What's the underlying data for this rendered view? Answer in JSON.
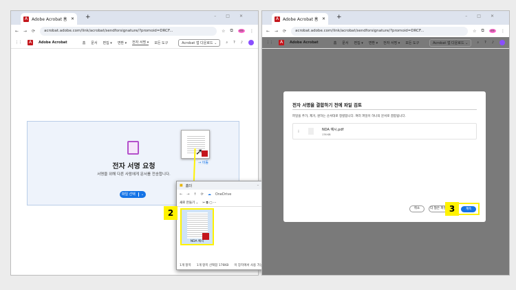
{
  "browser": {
    "tab_title": "Adobe Acrobat 홈",
    "url": "acrobat.adobe.com/link/acrobat/sendforsignature/?promoid=DRCF...",
    "profile": "ee"
  },
  "acrobat_nav": {
    "brand": "Adobe Acrobat",
    "items": [
      "홈",
      "문서",
      "편집 ▾",
      "변환 ▾",
      "전자 서명 ▾",
      "모든 도구"
    ],
    "download": "Acrobat 앱 다운로드 ⌄"
  },
  "left": {
    "title": "전자 서명 요청",
    "subtitle": "서명을 위해 다른 사람에게 문서를 전송합니다.",
    "select_button": "파일 선택",
    "move_label": "→ 이동",
    "step": "2"
  },
  "explorer": {
    "title": "홈더",
    "location": "OneDrive",
    "new_button": "새로 만들기 ⌄",
    "preview_button": "미리 보기",
    "file_name": "NDA 예시",
    "status": [
      "1개 항목",
      "1개 항목 선택함 176KB",
      "이 장치에서 사용 가능"
    ]
  },
  "dialog": {
    "title": "전자 서명을 결합하기 전에 파일 검토",
    "description": "파일을 추가, 제거, 원하는 순서대로 정렬합니다. 여러 파일이 하나의 문서로 결합됩니다.",
    "file_name": "NDA 예시.pdf",
    "file_size": "176 KB",
    "cancel": "취소",
    "add_more": "더 많은 파일",
    "continue": "계속",
    "step": "3"
  },
  "colors": {
    "accent": "#1473e6",
    "highlight": "#fff200",
    "acrobat_red": "#c4161c"
  }
}
